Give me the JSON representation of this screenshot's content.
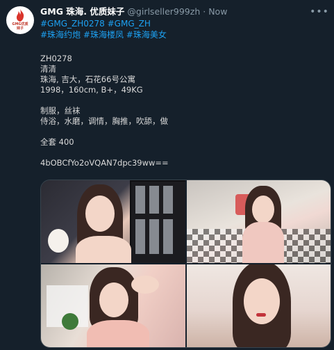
{
  "tweet": {
    "display_name": "GMG 珠海.  优质妹子",
    "handle": "@girlseller999zh",
    "separator": "·",
    "time": "Now",
    "more_icon": "more-dots-icon",
    "avatar": {
      "logo_text": "GMG优质",
      "logo_subtext": "妹子"
    },
    "hashtags": [
      "#GMG_ZH0278",
      "#GMG_ZH",
      "#珠海约炮",
      "#珠海楼凤",
      "#珠海美女"
    ],
    "body_lines": [
      "ZH0278",
      "清清",
      "珠海, 吉大，石花66号公寓",
      "1998，160cm, B+，49KG",
      "",
      "制服，丝袜",
      "侍浴，水磨，调情，胸推，吹舔，做",
      "",
      "全套 400",
      "",
      "4bOBCfYo2oVQAN7dpc39ww=="
    ],
    "media": {
      "photo_count": 4,
      "photos": [
        "photo-1",
        "photo-2",
        "photo-3",
        "photo-4"
      ]
    }
  },
  "colors": {
    "background": "#15202b",
    "link": "#1da1f2",
    "secondary_text": "#8899a6",
    "primary_text": "#d9d9d9",
    "logo_red": "#c0392b"
  }
}
